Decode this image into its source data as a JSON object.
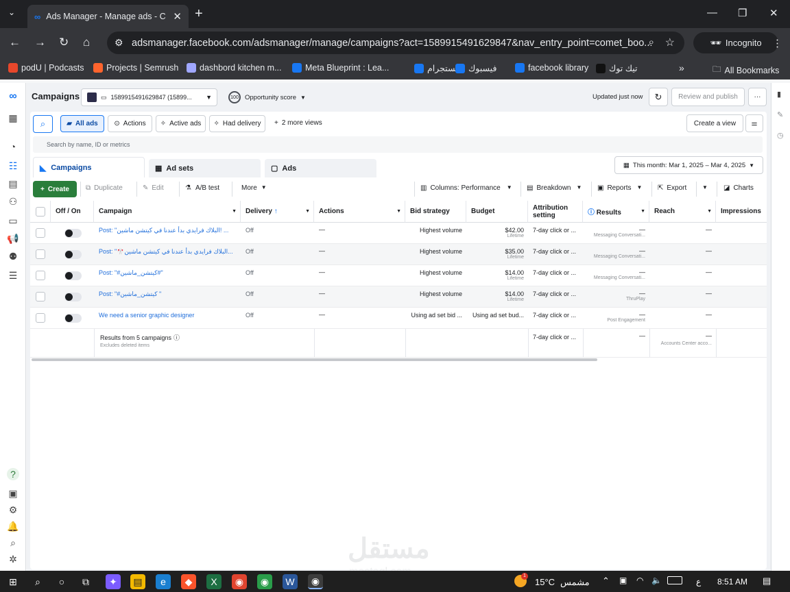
{
  "browser": {
    "tab_title": "Ads Manager - Manage ads - C",
    "url": "adsmanager.facebook.com/adsmanager/manage/campaigns?act=1589915491629847&nav_entry_point=comet_boo...",
    "incognito_label": "Incognito",
    "bookmarks": [
      {
        "label": "podU | Podcasts",
        "color": "#e8472b"
      },
      {
        "label": "Projects | Semrush",
        "color": "#ff642d"
      },
      {
        "label": "dashbord kitchen m...",
        "color": "#a0a7ff"
      },
      {
        "label": "Meta Blueprint : Lea...",
        "color": "#1877f2"
      },
      {
        "label": "انستجرام",
        "color": "#1877f2"
      },
      {
        "label": "فيسبوك",
        "color": "#1877f2"
      },
      {
        "label": "facebook library",
        "color": "#1877f2"
      },
      {
        "label": "تيك توك",
        "color": "#111111"
      }
    ],
    "all_bookmarks": "All Bookmarks"
  },
  "header": {
    "title": "Campaigns",
    "account": "1589915491629847 (15899...",
    "opportunity_score_value": "100",
    "opportunity_score_label": "Opportunity score",
    "updated": "Updated just now",
    "review_publish": "Review and publish"
  },
  "views": {
    "all_ads": "All ads",
    "actions": "Actions",
    "active_ads": "Active ads",
    "had_delivery": "Had delivery",
    "more_views": "2 more views",
    "create_view": "Create a view"
  },
  "search": {
    "placeholder": "Search by name, ID or metrics"
  },
  "tabs": {
    "campaigns": "Campaigns",
    "ad_sets": "Ad sets",
    "ads": "Ads"
  },
  "date_range": "This month: Mar 1, 2025 – Mar 4, 2025",
  "toolbar": {
    "create": "Create",
    "duplicate": "Duplicate",
    "edit": "Edit",
    "ab_test": "A/B test",
    "more": "More",
    "columns": "Columns: Performance",
    "breakdown": "Breakdown",
    "reports": "Reports",
    "export": "Export",
    "charts": "Charts"
  },
  "table": {
    "headers": {
      "off_on": "Off / On",
      "campaign": "Campaign",
      "delivery": "Delivery",
      "actions": "Actions",
      "bid_strategy": "Bid strategy",
      "budget": "Budget",
      "attribution": "Attribution setting",
      "results": "Results",
      "reach": "Reach",
      "impressions": "Impressions"
    },
    "rows": [
      {
        "campaign": "Post: \"البلاك فرايدي بدأ عندنا في كيتشن ماشين! ...",
        "delivery": "Off",
        "actions": "—",
        "bid": "Highest volume",
        "budget": "$42.00",
        "budget_sub": "Lifetime",
        "attribution": "7-day click or ...",
        "results": "—",
        "results_sub": "Messaging Conversati...",
        "reach": "—"
      },
      {
        "campaign": "Post: \"🎌البلاك فرايدي بدأ عندنا في كيتشن ماشين...",
        "delivery": "Off",
        "actions": "—",
        "bid": "Highest volume",
        "budget": "$35.00",
        "budget_sub": "Lifetime",
        "attribution": "7-day click or ...",
        "results": "—",
        "results_sub": "Messaging Conversati...",
        "reach": "—"
      },
      {
        "campaign": "Post: \"#كيتشن_ماشين#\"",
        "delivery": "Off",
        "actions": "—",
        "bid": "Highest volume",
        "budget": "$14.00",
        "budget_sub": "Lifetime",
        "attribution": "7-day click or ...",
        "results": "—",
        "results_sub": "Messaging Conversati...",
        "reach": "—"
      },
      {
        "campaign": "Post: \"#كيتشن_ماشين \"",
        "delivery": "Off",
        "actions": "—",
        "bid": "Highest volume",
        "budget": "$14.00",
        "budget_sub": "Lifetime",
        "attribution": "7-day click or ...",
        "results": "—",
        "results_sub": "ThruPlay",
        "reach": "—"
      },
      {
        "campaign": "We need a senior graphic designer",
        "delivery": "Off",
        "actions": "—",
        "bid": "Using ad set bid ...",
        "budget": "Using ad set bud...",
        "budget_sub": "",
        "attribution": "7-day click or ...",
        "results": "—",
        "results_sub": "Post Engagement",
        "reach": "—"
      }
    ],
    "summary": {
      "label": "Results from 5 campaigns",
      "sub": "Excludes deleted items",
      "attribution": "7-day click or ...",
      "results": "—",
      "reach": "—",
      "reach_sub": "Accounts Center acco..."
    }
  },
  "taskbar": {
    "weather_temp": "15°C",
    "weather_text": "مشمس",
    "lang": "ع",
    "time": "8:51 AM",
    "weather_badge": "1"
  }
}
